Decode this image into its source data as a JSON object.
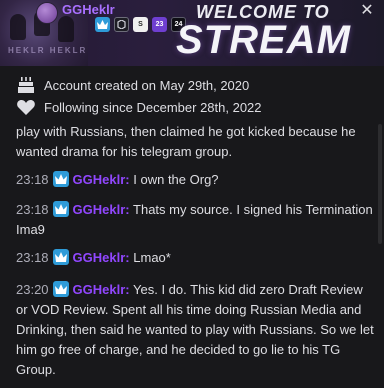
{
  "banner": {
    "username": "GGHeklr",
    "welcome": "WELCOME TO",
    "stream": "STREAM",
    "caption": "HEKLR  HEKLR",
    "badges": [
      {
        "icon": "crown-badge-icon"
      },
      {
        "icon": "prime-gaming-badge-icon"
      },
      {
        "icon": "sub-gift-badge-icon",
        "text": "S"
      },
      {
        "icon": "year-23-badge-icon",
        "text": "23"
      },
      {
        "icon": "year-24-badge-icon",
        "text": "24"
      }
    ]
  },
  "info": {
    "created": "Account created on May 29th, 2020",
    "following": "Following since December 28th, 2022"
  },
  "messages": [
    {
      "time": "",
      "author": "",
      "text": "play with Russians, then claimed he got kicked because he wanted drama for his telegram group."
    },
    {
      "time": "23:18",
      "author": "GGHeklr",
      "sep": ":",
      "text": "I own the Org?"
    },
    {
      "time": "23:18",
      "author": "GGHeklr",
      "sep": ":",
      "text": "Thats my source. I signed his Termination Ima9"
    },
    {
      "time": "23:18",
      "author": "GGHeklr",
      "sep": ":",
      "text": "Lmao*"
    },
    {
      "time": "23:20",
      "author": "GGHeklr",
      "sep": ":",
      "text": "Yes. I do. This kid did zero Draft Review or VOD Review. Spent all his time doing Russian Media and Drinking, then said he wanted to play with Russians. So we let him go free of charge, and he decided to go lie to his TG Group."
    }
  ],
  "colors": {
    "background": "#18181b",
    "author": "#9147ff",
    "badge": "#2e9bd8",
    "timestamp": "#adadb8"
  }
}
